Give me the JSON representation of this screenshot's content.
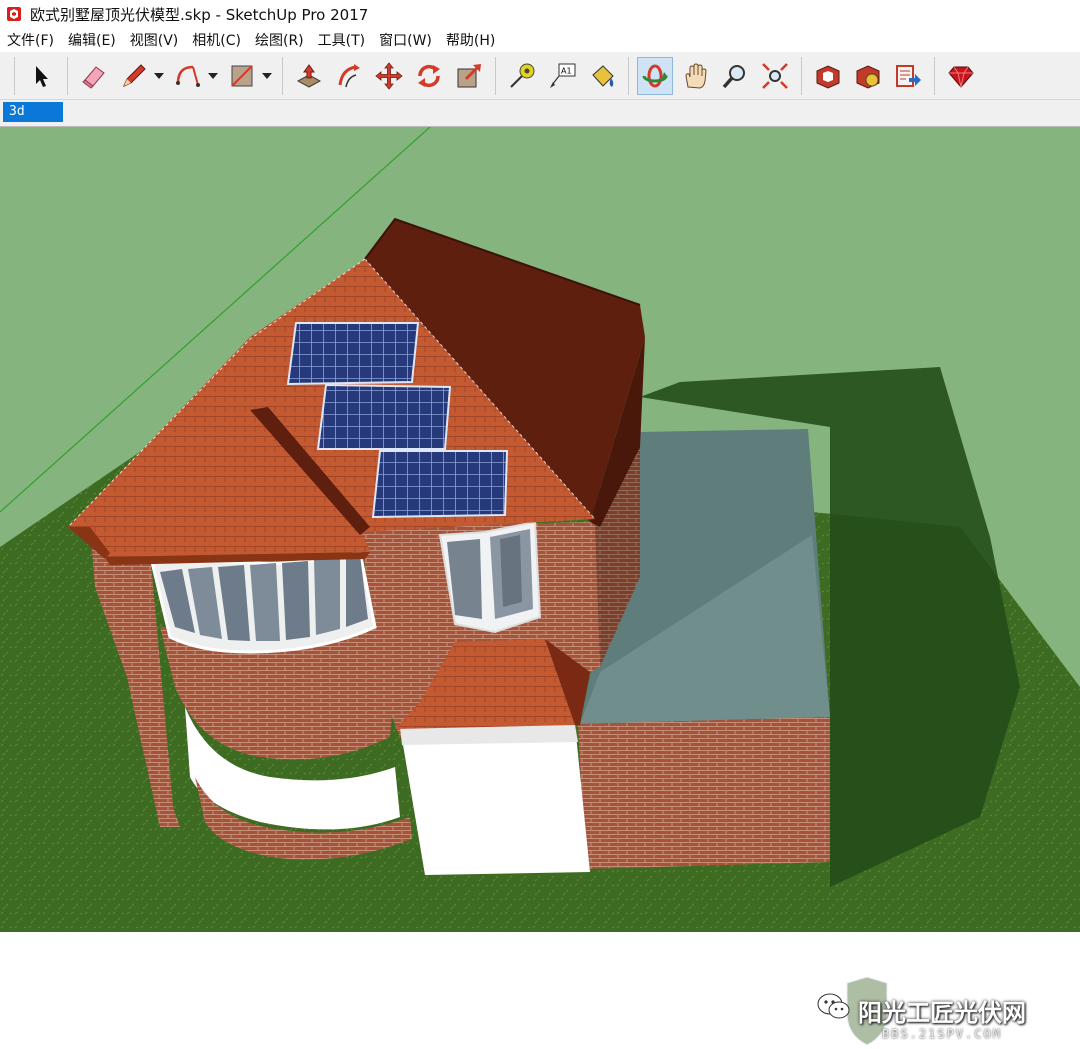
{
  "window": {
    "title": "欧式别墅屋顶光伏模型.skp - SketchUp Pro 2017",
    "app_icon": "sketchup-icon"
  },
  "menu": {
    "items": [
      "文件(F)",
      "编辑(E)",
      "视图(V)",
      "相机(C)",
      "绘图(R)",
      "工具(T)",
      "窗口(W)",
      "帮助(H)"
    ]
  },
  "toolbar": {
    "tools": [
      {
        "name": "select-icon"
      },
      {
        "name": "eraser-icon"
      },
      {
        "name": "pencil-icon",
        "dropdown": true
      },
      {
        "name": "arc-icon",
        "dropdown": true
      },
      {
        "name": "rectangle-icon",
        "dropdown": true
      },
      {
        "name": "push-pull-icon"
      },
      {
        "name": "offset-icon"
      },
      {
        "name": "move-icon"
      },
      {
        "name": "rotate-icon"
      },
      {
        "name": "scale-icon"
      },
      {
        "name": "tape-measure-icon"
      },
      {
        "name": "text-icon"
      },
      {
        "name": "paint-bucket-icon"
      },
      {
        "name": "orbit-icon",
        "active": true
      },
      {
        "name": "pan-icon"
      },
      {
        "name": "zoom-icon"
      },
      {
        "name": "zoom-extents-icon"
      },
      {
        "name": "3d-warehouse-icon"
      },
      {
        "name": "extension-warehouse-icon"
      },
      {
        "name": "send-to-layout-icon"
      },
      {
        "name": "ruby-console-icon"
      }
    ]
  },
  "scenes": {
    "tabs": [
      "3d"
    ]
  },
  "watermark": {
    "text": "阳光工匠光伏网",
    "url": "BBS.21SPV.COM"
  },
  "colors": {
    "sky": "#86b47e",
    "ground": "#3f6b22",
    "roof": "#c4562d",
    "roof_dark": "#5e1f0e",
    "brick": "#a9533a",
    "solar_panel": "#2a3f7a",
    "flat_roof": "#5f7d7a",
    "selected_tab": "#0a78d7"
  }
}
